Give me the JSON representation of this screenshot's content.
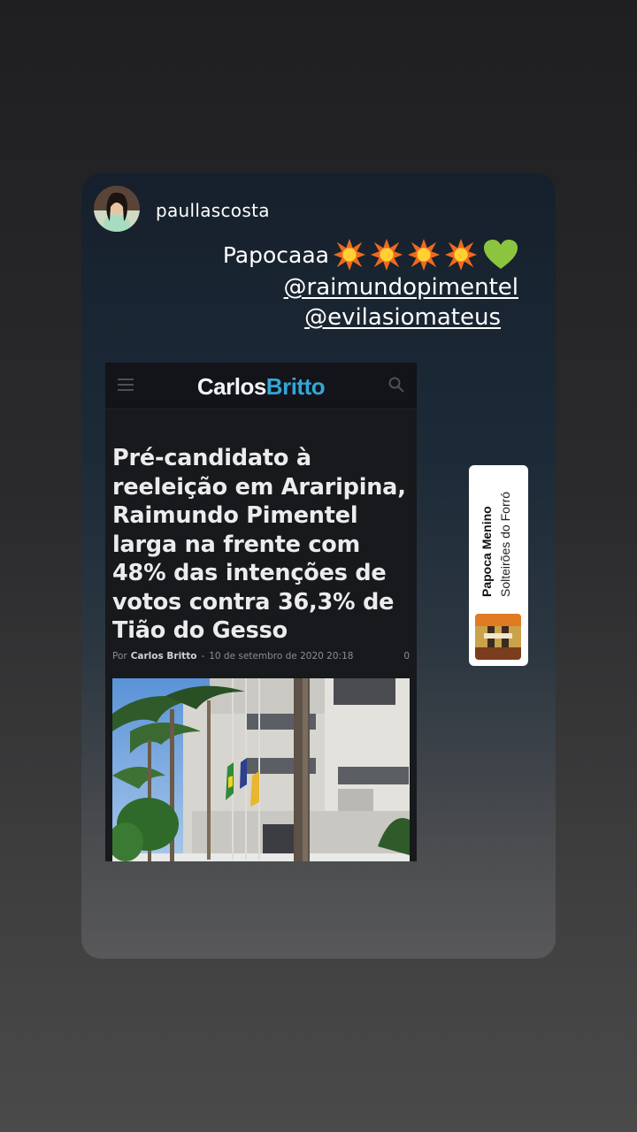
{
  "story": {
    "username": "paullascosta",
    "caption_text": "Papocaaa",
    "mentions": [
      "@raimundopimentel",
      "@evilasiomateus"
    ]
  },
  "article": {
    "logo_part1": "Carlos",
    "logo_part2": "Britto",
    "headline": "Pré-candidato à reeleição em Araripina, Raimundo Pimentel larga na frente com 48% das intenções de votos contra 36,3% de Tião do Gesso",
    "byline_prefix": "Por",
    "author": "Carlos Britto",
    "separator": "-",
    "date": "10 de setembro de 2020 20:18",
    "comments": "0"
  },
  "music_sticker": {
    "song": "Papoca Menino",
    "artist": "Solteirões do Forró"
  },
  "colors": {
    "logo_accent": "#34a7d6",
    "heart": "#8bc53f",
    "burst": "#f06a1e"
  },
  "icons": [
    "burst-emoji-icon",
    "green-heart-icon",
    "menu-icon",
    "search-icon",
    "album-art-icon"
  ]
}
